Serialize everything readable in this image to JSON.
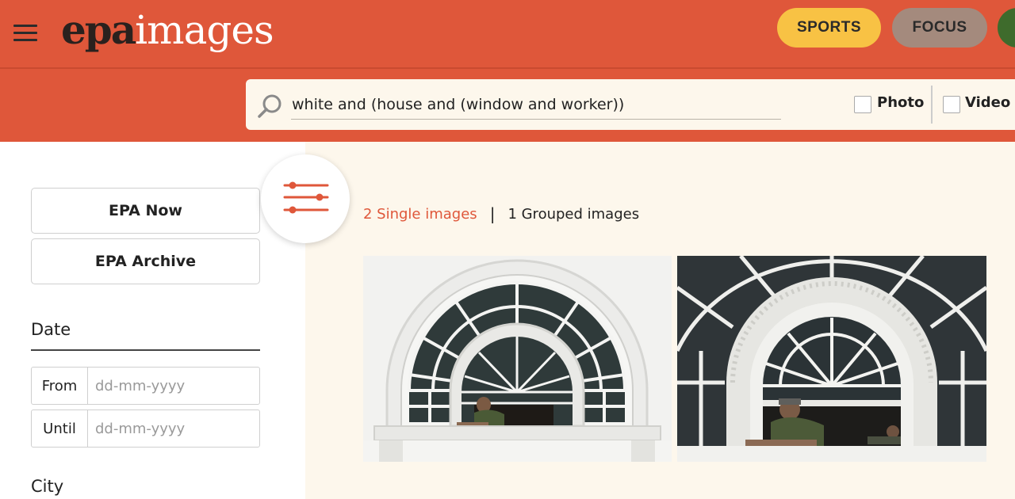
{
  "header": {
    "logo_epa": "epa",
    "logo_images": "images",
    "nav_pills": [
      {
        "label": "SPORTS",
        "color": "#f8c244"
      },
      {
        "label": "FOCUS",
        "color": "#a48a7d"
      }
    ],
    "brand_color": "#df573a"
  },
  "search": {
    "query": "white and (house and (window and worker))",
    "filters": [
      {
        "label": "Photo",
        "checked": false
      },
      {
        "label": "Video",
        "checked": false
      }
    ]
  },
  "sidebar": {
    "buttons": [
      "EPA Now",
      "EPA Archive"
    ],
    "date": {
      "title": "Date",
      "from_label": "From",
      "until_label": "Until",
      "placeholder": "dd-mm-yyyy"
    },
    "city_title": "City"
  },
  "results": {
    "single": "2 Single images",
    "separator": "|",
    "grouped": "1 Grouped images"
  },
  "thumbnails": [
    {
      "subject": "arched window on white building with worker leaning out"
    },
    {
      "subject": "close-up arched fanlight window with worker leaning out"
    }
  ]
}
